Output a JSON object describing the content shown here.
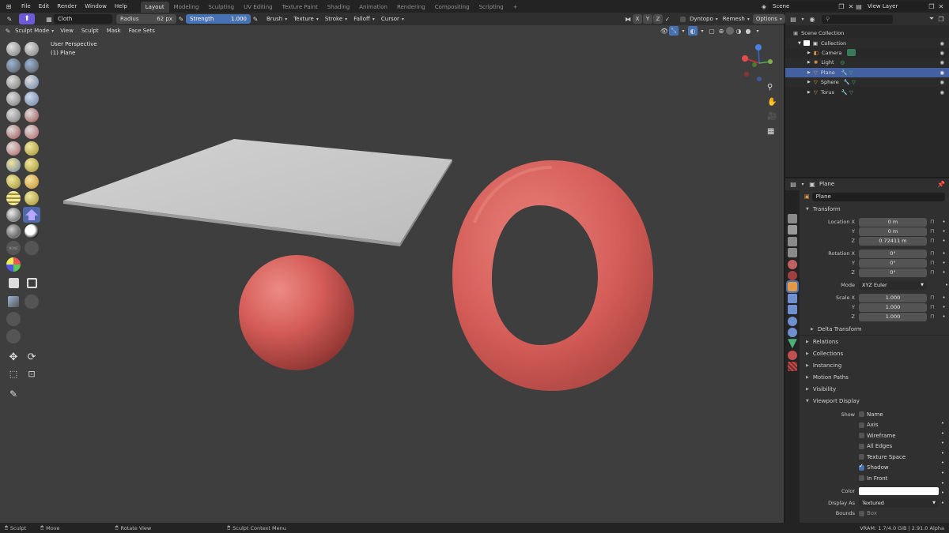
{
  "menubar": {
    "menus": [
      "File",
      "Edit",
      "Render",
      "Window",
      "Help"
    ],
    "workspaces": [
      "Layout",
      "Modeling",
      "Sculpting",
      "UV Editing",
      "Texture Paint",
      "Shading",
      "Animation",
      "Rendering",
      "Compositing",
      "Scripting"
    ],
    "active_workspace": "Layout",
    "add_tab": "+",
    "scene": "Scene",
    "view_layer": "View Layer"
  },
  "tool_header": {
    "brush_name": "Cloth",
    "radius_label": "Radius",
    "radius_value": "62 px",
    "strength_label": "Strength",
    "strength_value": "1.000",
    "menus": [
      "Brush",
      "Texture",
      "Stroke",
      "Falloff",
      "Cursor"
    ],
    "axes": [
      "X",
      "Y",
      "Z"
    ],
    "dyntopo": "Dyntopo",
    "remesh": "Remesh",
    "options": "Options"
  },
  "viewport_header": {
    "mode": "Sculpt Mode",
    "menus": [
      "View",
      "Sculpt",
      "Mask",
      "Face Sets"
    ]
  },
  "viewport": {
    "perspective": "User Perspective",
    "object_label": "(1) Plane"
  },
  "outliner": {
    "root": "Scene Collection",
    "items": [
      {
        "label": "Collection"
      },
      {
        "label": "Camera"
      },
      {
        "label": "Light"
      },
      {
        "label": "Plane"
      },
      {
        "label": "Sphere"
      },
      {
        "label": "Torus"
      }
    ],
    "selected": "Plane"
  },
  "properties": {
    "object_name": "Plane",
    "data_name": "Plane",
    "transform_title": "Transform",
    "location_label": "Location X",
    "location": [
      "0 m",
      "0 m",
      "0.72411 m"
    ],
    "rotation_label": "Rotation X",
    "rotation": [
      "0°",
      "0°",
      "0°"
    ],
    "mode_label": "Mode",
    "mode_value": "XYZ Euler",
    "scale_label": "Scale X",
    "scale": [
      "1.000",
      "1.000",
      "1.000"
    ],
    "y_label": "Y",
    "z_label": "Z",
    "delta_transform": "Delta Transform",
    "sections": [
      "Relations",
      "Collections",
      "Instancing",
      "Motion Paths",
      "Visibility"
    ],
    "viewport_display": "Viewport Display",
    "show_label": "Show",
    "show_options": [
      {
        "label": "Name",
        "checked": false
      },
      {
        "label": "Axis",
        "checked": false
      },
      {
        "label": "Wireframe",
        "checked": false
      },
      {
        "label": "All Edges",
        "checked": false
      },
      {
        "label": "Texture Space",
        "checked": false
      },
      {
        "label": "Shadow",
        "checked": true
      },
      {
        "label": "In Front",
        "checked": false
      }
    ],
    "color_label": "Color",
    "display_as_label": "Display As",
    "display_as_value": "Textured",
    "bounds_label": "Bounds",
    "bounds_value": "Box"
  },
  "statusbar": {
    "items": [
      "Sculpt",
      "Move",
      "Rotate View",
      "Sculpt Context Menu"
    ],
    "vram": "VRAM: 1.7/4.0 GiB | 2.91.0 Alpha"
  },
  "colors": {
    "accent": "#4772b3",
    "selection": "#4361a0",
    "mesh_red": "#d45c57",
    "plane_gray": "#c8c8c8",
    "viewport_bg": "#3e3e3e"
  }
}
